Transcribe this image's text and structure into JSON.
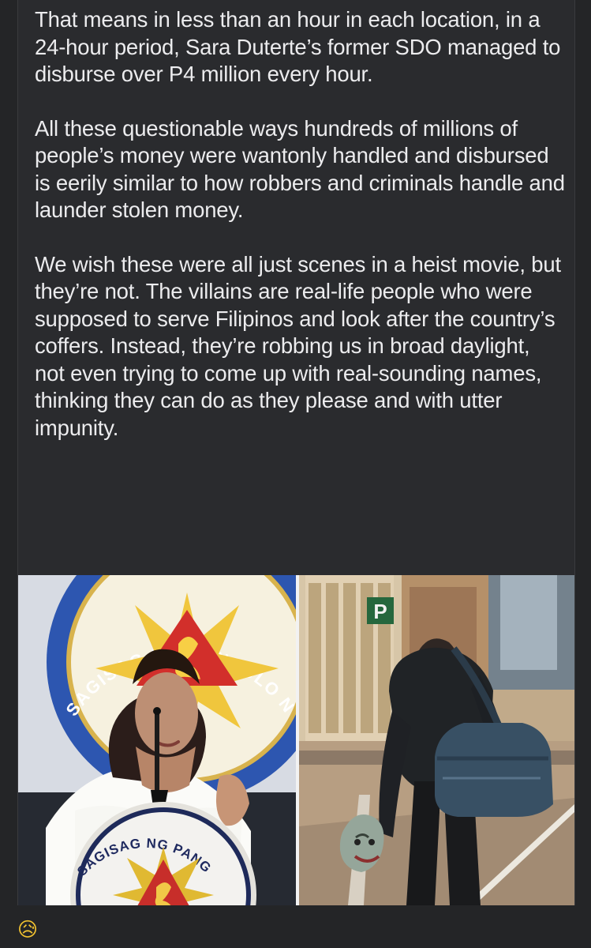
{
  "post": {
    "paragraphs": [
      "That means in less than an hour in each location, in a 24-hour period, Sara Duterte’s former SDO managed to disburse over P4 million every hour.",
      "All these questionable ways hundreds of millions of people’s money were wantonly handled and disbursed is eerily similar to how robbers and criminals handle and launder stolen money.",
      "We wish these were all just scenes in a heist movie, but they’re not. The villains are real-life people who were supposed to serve Filipinos and look after the country’s coffers. Instead, they’re robbing us in broad daylight, not even trying to come up with real-sounding names, thinking they can do as they please and with utter impunity."
    ]
  },
  "images": {
    "left": {
      "seal_top_text": "SAGISAG NG PANGULO NG PILIPINAS",
      "seal_bottom_text": "SAGISAG NG PANGALAWANG PANGULO NG PILIPINAS"
    },
    "right": {
      "parking_sign": "P"
    }
  },
  "reaction": {
    "emoji": "😥",
    "icon": "sad-face-icon"
  }
}
